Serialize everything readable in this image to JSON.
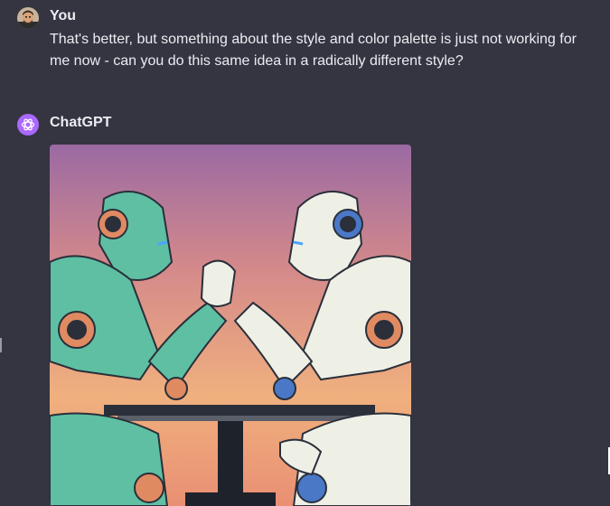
{
  "user_message": {
    "author": "You",
    "text": "That's better, but something about the style and color palette is just not working for me now - can you do this same idea in a radically different style?"
  },
  "assistant_message": {
    "author": "ChatGPT",
    "image_alt": "Two stylized robots arm wrestling across a table"
  },
  "colors": {
    "background": "#343541",
    "text": "#ececf1",
    "assistant_avatar": "#ab68ff",
    "user_avatar": "#d9c3a5"
  }
}
